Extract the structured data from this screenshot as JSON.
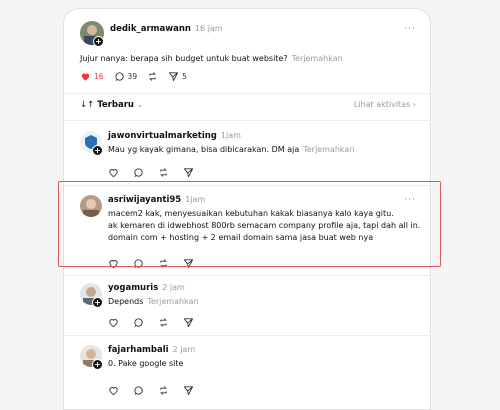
{
  "main_post": {
    "username": "dedik_armawann",
    "time": "16 jam",
    "text": "Jujur nanya: berapa sih budget untuk buat website?",
    "translate": "Terjemahkan",
    "likes": "16",
    "comments": "39",
    "shares": "5"
  },
  "sort": {
    "label": "Terbaru",
    "activity": "Lihat aktivitas"
  },
  "replies": [
    {
      "username": "jawonvirtualmarketing",
      "time": "1jam",
      "lines": [
        "Mau yg kayak gimana, bisa dibicarakan. DM aja"
      ],
      "translate": "Terjemahkan"
    },
    {
      "username": "asriwijayanti95",
      "time": "1jam",
      "lines": [
        "macem2 kak, menyesuaikan kebutuhan kakak biasanya kalo kaya gitu.",
        "ak kemaren di idwebhost 800rb semacam company profile aja, tapi dah all in.",
        "domain com + hosting + 2 email domain sama jasa buat web nya"
      ]
    },
    {
      "username": "yogamuris",
      "time": "2 jam",
      "lines": [
        "Depends"
      ],
      "translate": "Terjemahkan"
    },
    {
      "username": "fajarhambali",
      "time": "2 jam",
      "lines": [
        "0. Pake google site"
      ]
    }
  ],
  "colors": {
    "like": "#ff3040",
    "highlight": "#e05a5a"
  }
}
